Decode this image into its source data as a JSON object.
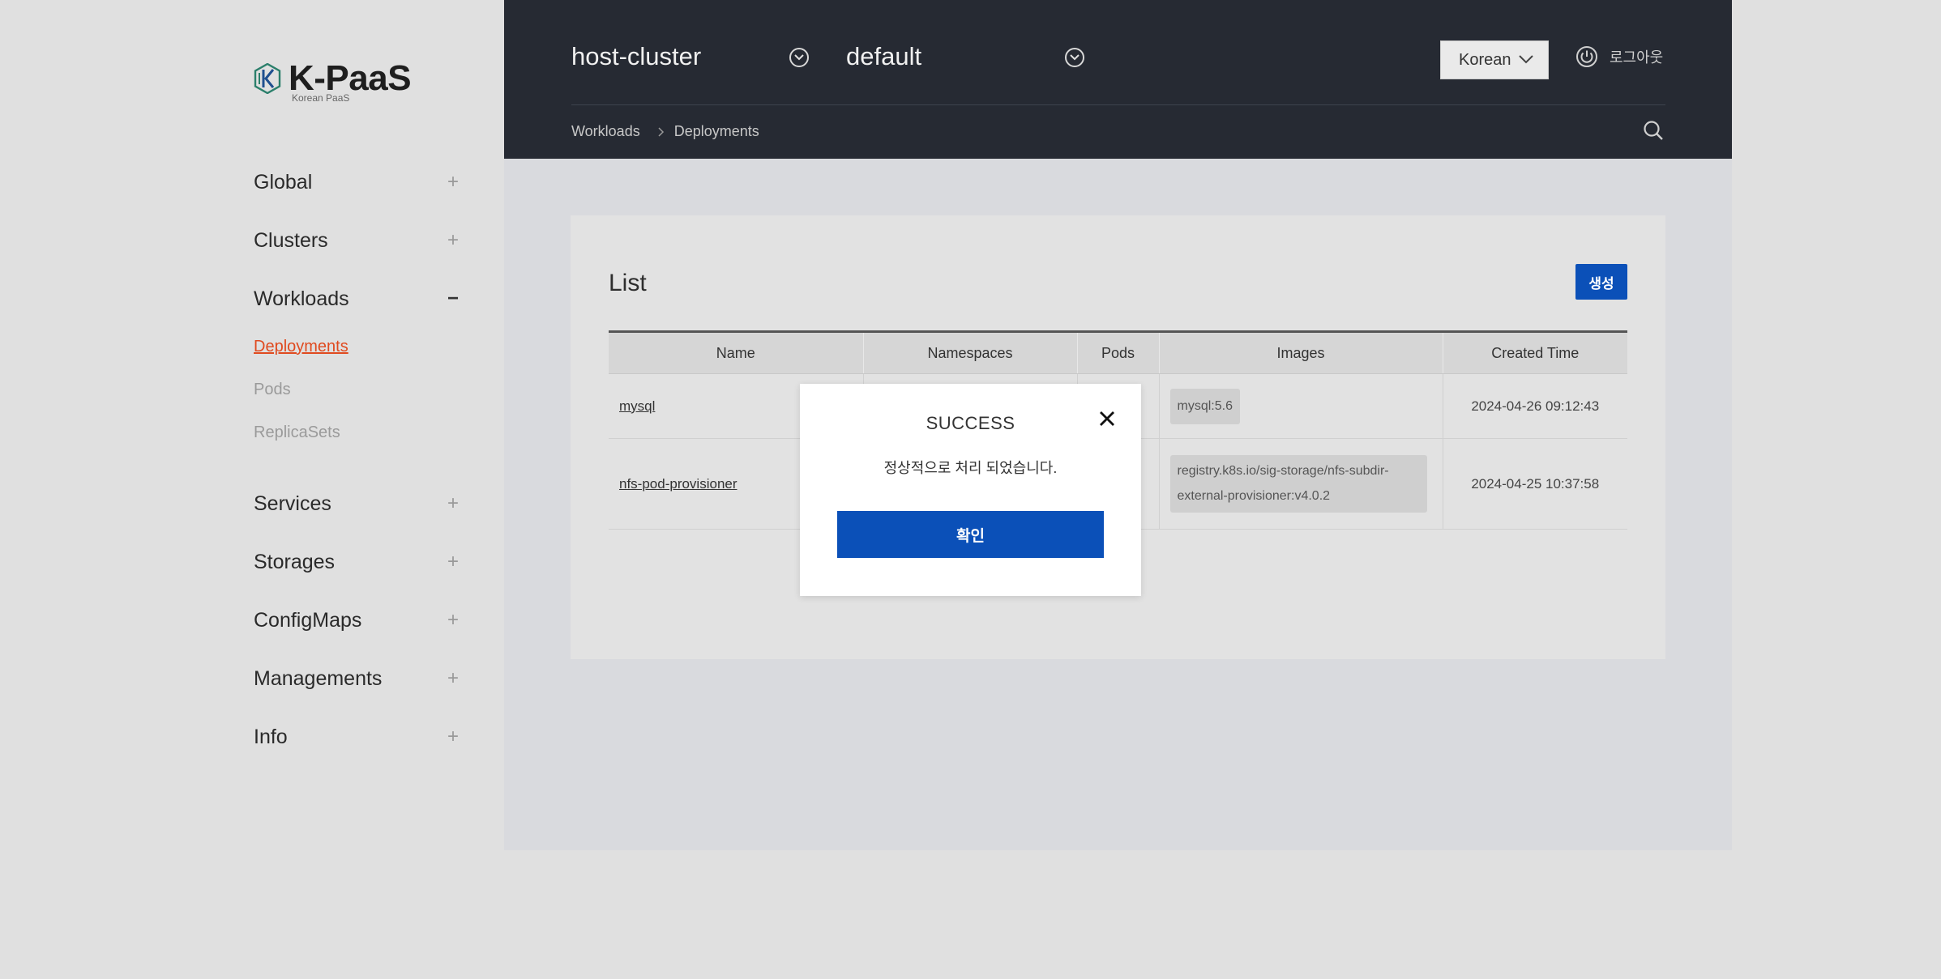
{
  "brand": {
    "name": "K-PaaS",
    "tagline": "Korean PaaS"
  },
  "sidebar": {
    "items": [
      {
        "label": "Global",
        "toggle": "+"
      },
      {
        "label": "Clusters",
        "toggle": "+"
      },
      {
        "label": "Workloads",
        "toggle": "−"
      },
      {
        "label": "Services",
        "toggle": "+"
      },
      {
        "label": "Storages",
        "toggle": "+"
      },
      {
        "label": "ConfigMaps",
        "toggle": "+"
      },
      {
        "label": "Managements",
        "toggle": "+"
      },
      {
        "label": "Info",
        "toggle": "+"
      }
    ],
    "workloads_sub": [
      {
        "label": "Deployments",
        "active": true
      },
      {
        "label": "Pods"
      },
      {
        "label": "ReplicaSets"
      }
    ]
  },
  "header": {
    "cluster": "host-cluster",
    "namespace": "default",
    "language": "Korean",
    "logout_label": "로그아웃",
    "breadcrumb": [
      "Workloads",
      "Deployments"
    ]
  },
  "list": {
    "title": "List",
    "create_label": "생성",
    "columns": [
      "Name",
      "Namespaces",
      "Pods",
      "Images",
      "Created Time"
    ],
    "rows": [
      {
        "name": "mysql",
        "image": "mysql:5.6",
        "created": "2024-04-26 09:12:43"
      },
      {
        "name": "nfs-pod-provisioner",
        "image": "registry.k8s.io/sig-storage/nfs-subdir-external-provisioner:v4.0.2",
        "created": "2024-04-25 10:37:58"
      }
    ]
  },
  "modal": {
    "title": "SUCCESS",
    "message": "정상적으로 처리 되었습니다.",
    "confirm_label": "확인"
  },
  "colors": {
    "header_bg": "#262a33",
    "accent_blue": "#0b50b8",
    "active_nav": "#e04a1f",
    "page_bg": "#e0e0e0"
  },
  "icons": {
    "selector": "chevron-circle-icon",
    "logout": "power-icon",
    "search": "search-icon",
    "close": "close-icon"
  }
}
